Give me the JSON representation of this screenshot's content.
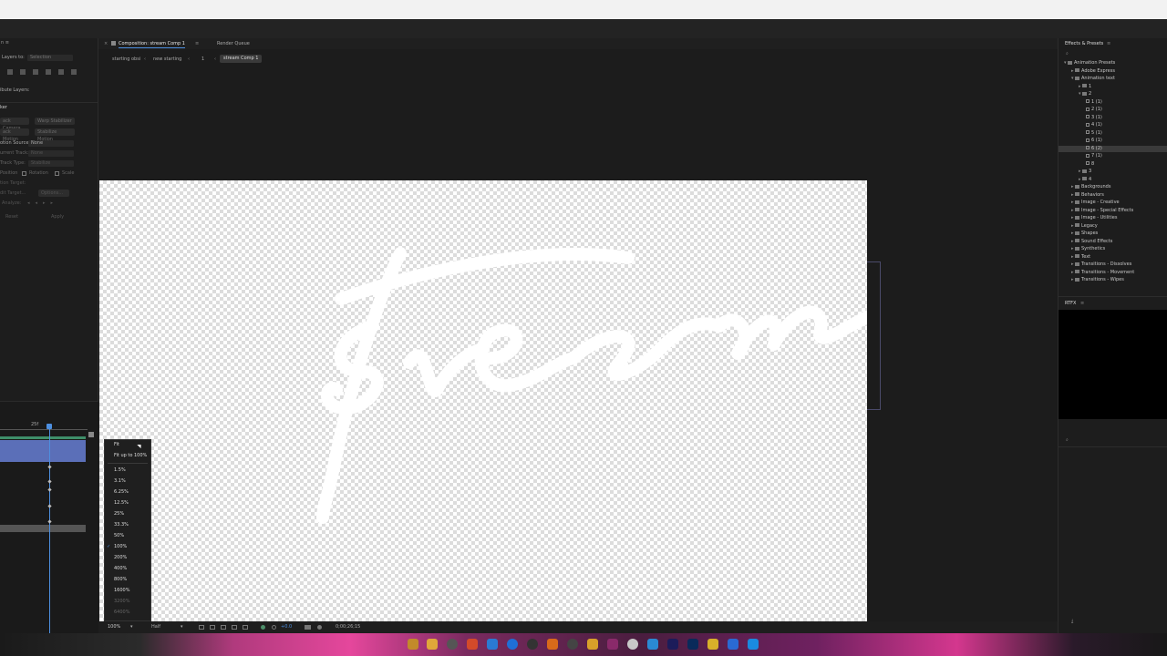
{
  "window": {
    "comp_tab_label": "Composition: stream Comp 1",
    "render_queue_label": "Render Queue"
  },
  "breadcrumb": [
    "starting obsi",
    "new starting",
    "1",
    "stream Comp 1"
  ],
  "left_panel": {
    "align_layers_to_label": "Layers to:",
    "align_layers_to_value": "Selection",
    "distribute_label": "ibute Layers:",
    "tracker_title": "ker",
    "track_camera": "ack Camera",
    "warp_stabilizer": "Warp Stabilizer",
    "track_motion": "ack Motion",
    "stabilize_motion": "Stabilize Motion",
    "motion_source_label": "otion Source:",
    "motion_source_value": "None",
    "current_track_label": "urrent Track:",
    "current_track_value": "None",
    "track_type_label": "Track Type:",
    "track_type_value": "Stabilize",
    "position_label": "Position",
    "rotation_label": "Rotation",
    "scale_label": "Scale",
    "motion_target_label": "tion Target:",
    "edit_target_label": "dit Target...",
    "options_label": "Options...",
    "analyze_label": "Analyze:",
    "reset_label": "Reset",
    "apply_label": "Apply"
  },
  "timeline": {
    "ruler_label_left": "25f"
  },
  "zoom_menu": {
    "items": [
      "Fit",
      "Fit up to 100%",
      "1.5%",
      "3.1%",
      "6.25%",
      "12.5%",
      "25%",
      "33.3%",
      "50%",
      "100%",
      "200%",
      "400%",
      "800%",
      "1600%",
      "3200%",
      "6400%"
    ],
    "selected": "100%"
  },
  "comp_footer": {
    "zoom": "100%",
    "resolution": "Half",
    "timecode": "0;00;26;15",
    "exposure": "+0.0"
  },
  "canvas_text": "stream",
  "right_panel": {
    "effects_title": "Effects & Presets",
    "search_placeholder": "",
    "tree": [
      {
        "label": "Animation Presets",
        "indent": 0,
        "type": "folder",
        "open": true
      },
      {
        "label": "Adobe Express",
        "indent": 1,
        "type": "folder",
        "open": false
      },
      {
        "label": "Animation text",
        "indent": 1,
        "type": "folder",
        "open": true
      },
      {
        "label": "1",
        "indent": 2,
        "type": "folder",
        "open": false
      },
      {
        "label": "2",
        "indent": 2,
        "type": "folder",
        "open": true
      },
      {
        "label": "1 (1)",
        "indent": 3,
        "type": "preset"
      },
      {
        "label": "2 (1)",
        "indent": 3,
        "type": "preset"
      },
      {
        "label": "3 (1)",
        "indent": 3,
        "type": "preset"
      },
      {
        "label": "4 (1)",
        "indent": 3,
        "type": "preset"
      },
      {
        "label": "5 (1)",
        "indent": 3,
        "type": "preset"
      },
      {
        "label": "6 (1)",
        "indent": 3,
        "type": "preset"
      },
      {
        "label": "6 (2)",
        "indent": 3,
        "type": "preset",
        "selected": true
      },
      {
        "label": "7 (1)",
        "indent": 3,
        "type": "preset"
      },
      {
        "label": "8",
        "indent": 3,
        "type": "preset"
      },
      {
        "label": "3",
        "indent": 2,
        "type": "folder",
        "open": false
      },
      {
        "label": "4",
        "indent": 2,
        "type": "folder",
        "open": false
      },
      {
        "label": "Backgrounds",
        "indent": 1,
        "type": "folder",
        "open": false
      },
      {
        "label": "Behaviors",
        "indent": 1,
        "type": "folder",
        "open": false
      },
      {
        "label": "Image - Creative",
        "indent": 1,
        "type": "folder",
        "open": false
      },
      {
        "label": "Image - Special Effects",
        "indent": 1,
        "type": "folder",
        "open": false
      },
      {
        "label": "Image - Utilities",
        "indent": 1,
        "type": "folder",
        "open": false
      },
      {
        "label": "Legacy",
        "indent": 1,
        "type": "folder",
        "open": false
      },
      {
        "label": "Shapes",
        "indent": 1,
        "type": "folder",
        "open": false
      },
      {
        "label": "Sound Effects",
        "indent": 1,
        "type": "folder",
        "open": false
      },
      {
        "label": "Synthetics",
        "indent": 1,
        "type": "folder",
        "open": false
      },
      {
        "label": "Text",
        "indent": 1,
        "type": "folder",
        "open": false
      },
      {
        "label": "Transitions - Dissolves",
        "indent": 1,
        "type": "folder",
        "open": false
      },
      {
        "label": "Transitions - Movement",
        "indent": 1,
        "type": "folder",
        "open": false
      },
      {
        "label": "Transitions - Wipes",
        "indent": 1,
        "type": "folder",
        "open": false
      }
    ],
    "rtfx_title": "RTFX"
  },
  "colors": {
    "timeline_bar_blue": "#5b6fb8",
    "timeline_bar_green": "#3f8f6a",
    "playhead": "#4d8fe0"
  }
}
